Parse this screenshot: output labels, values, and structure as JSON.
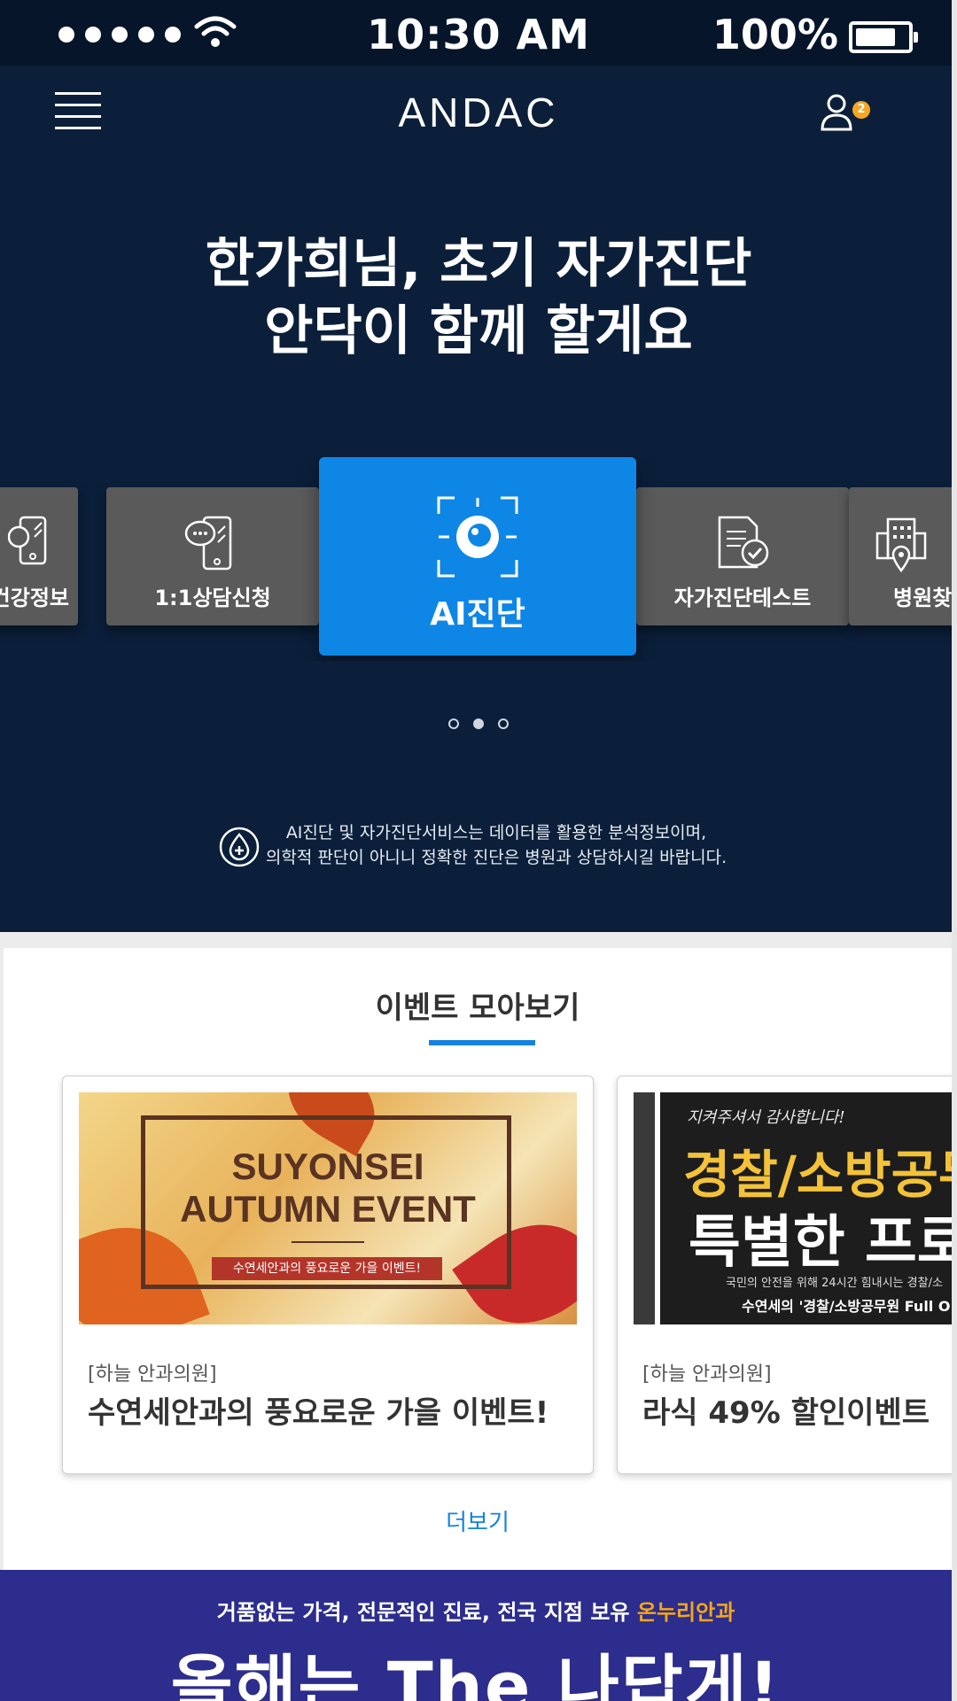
{
  "status_bar": {
    "time": "10:30 AM",
    "battery": "100%"
  },
  "header": {
    "title": "ANDAC",
    "profile_badge_count": "2",
    "icons": {
      "menu": "hamburger-menu-icon",
      "profile": "user-icon"
    }
  },
  "hero": {
    "headline_line1": "한가희님, 초기 자가진단",
    "headline_line2": "안닥이 함께 할게요",
    "cards": [
      {
        "label": "건강정보",
        "icon": "phone-health-icon"
      },
      {
        "label": "1:1상담신청",
        "icon": "phone-chat-icon"
      },
      {
        "label": "AI진단",
        "icon": "eye-scan-icon"
      },
      {
        "label": "자가진단테스트",
        "icon": "checklist-icon"
      },
      {
        "label": "병원찾기",
        "icon": "hospital-icon"
      }
    ],
    "active_card_index": 2,
    "pager": {
      "count": 3,
      "active": 1
    },
    "disclaimer_line1": "AI진단 및 자가진단서비스는 데이터를 활용한 분석정보이며,",
    "disclaimer_line2": "의학적 판단이 아니니 정확한 진단은 병원과 상담하시길 바랍니다."
  },
  "events": {
    "title": "이벤트 모아보기",
    "more_label": "더보기",
    "items": [
      {
        "clinic": "[하늘 안과의원]",
        "title": "수연세안과의 풍요로운 가을 이벤트!",
        "image_text1": "SUYONSEI",
        "image_text2": "AUTUMN EVENT",
        "image_tag": "수연세안과의 풍요로운 가을 이벤트!"
      },
      {
        "clinic": "[하늘 안과의원]",
        "title": "라식 49% 할인이벤트",
        "image_text1": "지켜주셔서 감사합니다!",
        "image_text2": "경찰/소방공무",
        "image_text3": "특별한 프로",
        "image_text4": "국민의 안전을 위해 24시간 힘내시는 경찰/소",
        "image_text5": "수연세의 '경찰/소방공무원 Full O"
      }
    ]
  },
  "banner": {
    "line1_prefix": "거품없는 가격, 전문적인 진료, 전국 지점 보유",
    "line1_highlight": "온누리안과",
    "line2": "올해는 The 나답게!"
  },
  "colors": {
    "hero_bg": "#0b1f3a",
    "active_card": "#0e86e6",
    "inactive_card": "#5a5a5a",
    "accent": "#1483df",
    "banner_bg": "#2c2d8c",
    "banner_highlight": "#f6a61b"
  }
}
